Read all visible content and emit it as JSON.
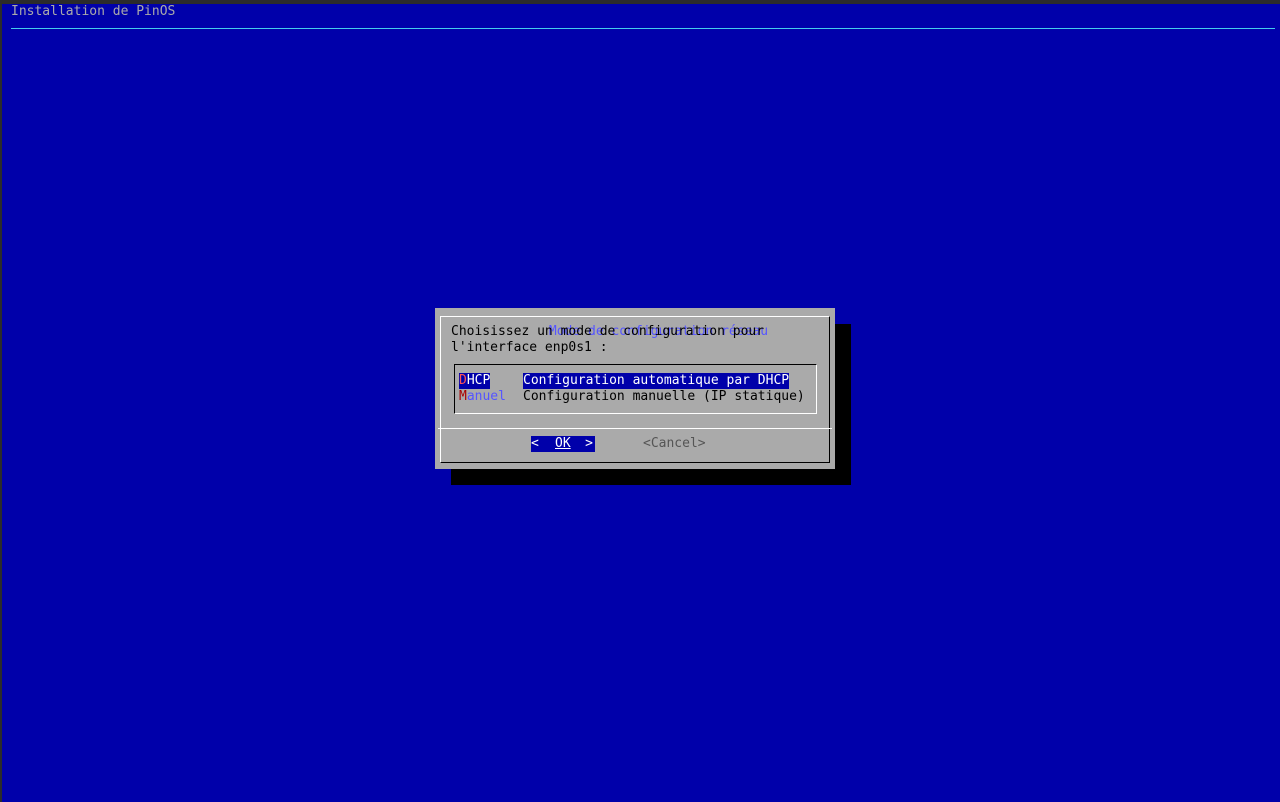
{
  "screen": {
    "backtitle": "Installation de PinOS",
    "background_color": "#0000aa"
  },
  "dialog": {
    "title": "Mode de configuration réseau",
    "prompt_line1": "Choisissez un mode de configuration pour",
    "prompt_line2": "l'interface enp0s1 :",
    "menu_items": [
      {
        "tag_hotkey": "D",
        "tag_rest": "HCP",
        "description": "Configuration automatique par DHCP",
        "selected": true
      },
      {
        "tag_hotkey": "M",
        "tag_rest": "anuel",
        "description": "Configuration manuelle (IP statique)",
        "selected": false
      }
    ],
    "buttons": {
      "ok_left": "<",
      "ok_label": "OK",
      "ok_right": ">",
      "cancel_label": "<Cancel>"
    }
  },
  "colors": {
    "dialog_bg": "#aaaaaa",
    "title": "#5555ff",
    "selection_bg": "#0000aa",
    "hotkey": "#aa0000"
  }
}
